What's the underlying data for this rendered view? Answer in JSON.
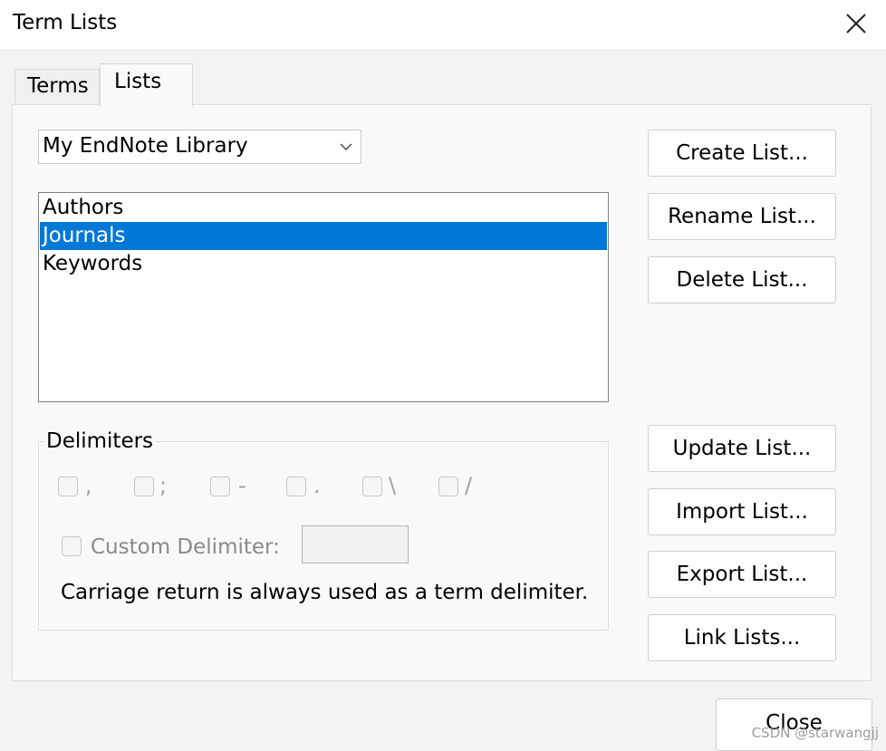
{
  "window": {
    "title": "Term Lists"
  },
  "tabs": [
    {
      "label": "Terms",
      "active": false
    },
    {
      "label": "Lists",
      "active": true
    }
  ],
  "library_select": {
    "value": "My EndNote Library"
  },
  "lists": {
    "items": [
      "Authors",
      "Journals",
      "Keywords"
    ],
    "selected": "Journals"
  },
  "buttons": {
    "create": "Create List...",
    "rename": "Rename List...",
    "delete": "Delete List...",
    "update": "Update List...",
    "import": "Import List...",
    "export": "Export List...",
    "link": "Link Lists...",
    "close": "Close"
  },
  "delimiters": {
    "label": "Delimiters",
    "options": [
      ",",
      ";",
      "-",
      ".",
      "\\",
      "/"
    ],
    "custom_label": "Custom Delimiter:",
    "custom_value": "",
    "note": "Carriage return is always used as a term delimiter."
  },
  "watermark": "CSDN @starwangjj",
  "colors": {
    "selection": "#0078d7",
    "disabled_text": "#8a8a8a"
  }
}
